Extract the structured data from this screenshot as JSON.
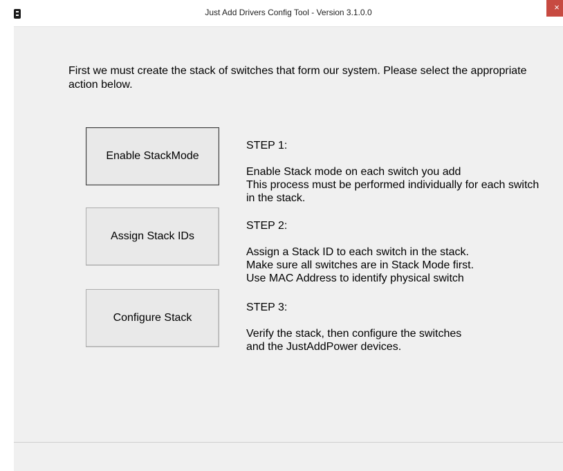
{
  "window": {
    "title": "Just Add Drivers Config Tool - Version 3.1.0.0",
    "close_glyph": "×",
    "icon": "app-icon"
  },
  "intro": {
    "text": "First we must create the stack of switches that form our system. Please select the appropriate action below."
  },
  "steps": [
    {
      "button_label": "Enable StackMode",
      "heading": "STEP 1:",
      "description": "Enable Stack mode on each switch you add\nThis process must be performed individually for each switch in the stack."
    },
    {
      "button_label": "Assign Stack IDs",
      "heading": "STEP 2:",
      "description": "Assign a Stack ID to each switch in the stack.\nMake sure all switches are in Stack Mode first.\nUse MAC Address to identify physical switch"
    },
    {
      "button_label": "Configure Stack",
      "heading": "STEP 3:",
      "description": "Verify the stack, then configure the switches\nand the JustAddPower devices."
    }
  ],
  "colors": {
    "client_background": "#f0f0f0",
    "close_button": "#c74a41",
    "button_face": "#e9e9e9"
  }
}
